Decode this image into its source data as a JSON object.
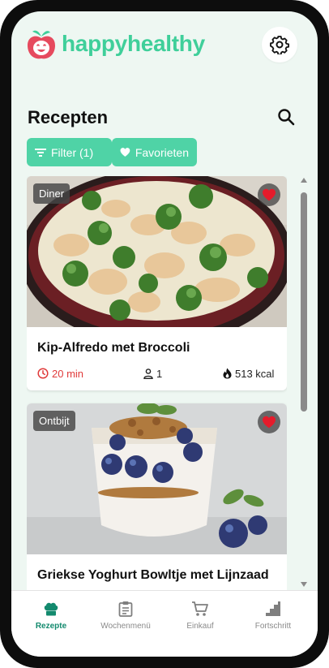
{
  "app": {
    "brand_name": "happyhealthy",
    "accent_color": "#4fd3a6",
    "brand_color": "#3fcf9a"
  },
  "header": {
    "logo_icon": "apple-icon",
    "settings_icon": "gear-icon"
  },
  "page": {
    "title": "Recepten",
    "search_icon": "search-icon"
  },
  "filters": {
    "filter_label": "Filter (1)",
    "favorites_label": "Favorieten"
  },
  "recipes": [
    {
      "tag": "Diner",
      "title": "Kip-Alfredo met Broccoli",
      "time": "20 min",
      "servings": "1",
      "calories": "513 kcal",
      "favorite": true,
      "image": "chicken-alfredo-broccoli-pan"
    },
    {
      "tag": "Ontbijt",
      "title": "Griekse Yoghurt Bowltje met Lijnzaad",
      "favorite": true,
      "image": "greek-yogurt-blueberry-glass"
    }
  ],
  "bottom_nav": [
    {
      "label": "Rezepte",
      "icon": "chef-hat-icon",
      "active": true
    },
    {
      "label": "Wochenmenü",
      "icon": "clipboard-icon",
      "active": false
    },
    {
      "label": "Einkauf",
      "icon": "cart-icon",
      "active": false
    },
    {
      "label": "Fortschritt",
      "icon": "stairs-icon",
      "active": false
    }
  ]
}
